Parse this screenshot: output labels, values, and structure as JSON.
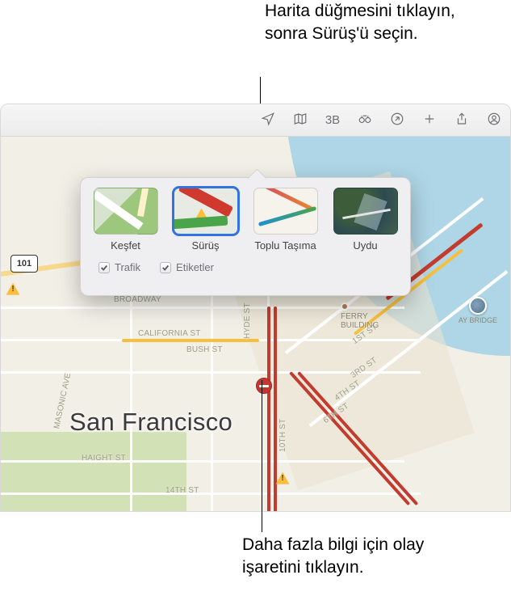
{
  "callouts": {
    "top": "Harita düğmesini tıklayın, sonra Sürüş'ü seçin.",
    "bottom": "Daha fazla bilgi için olay işaretini tıklayın."
  },
  "toolbar": {
    "mode3d": "3B"
  },
  "popover": {
    "types": {
      "explore": "Keşfet",
      "drive": "Sürüş",
      "transit": "Toplu Taşıma",
      "satellite": "Uydu"
    },
    "checks": {
      "traffic": "Trafik",
      "labels": "Etiketler"
    }
  },
  "map": {
    "city": "San Francisco",
    "route_shield": "101",
    "poi_ferry_l1": "FERRY",
    "poi_ferry_l2": "BUILDING",
    "bay_badge": "AY BRIDGE",
    "streets": {
      "broadway": "BROADWAY",
      "california": "CALIFORNIA ST",
      "bush": "BUSH ST",
      "hyde": "HYDE ST",
      "masonic": "MASONIC AVE",
      "haight": "HAIGHT ST",
      "tenth": "10TH ST",
      "fourteenth": "14TH ST",
      "first": "1ST ST",
      "third": "3RD ST",
      "fourth": "4TH ST",
      "sixth": "6TH ST"
    }
  }
}
